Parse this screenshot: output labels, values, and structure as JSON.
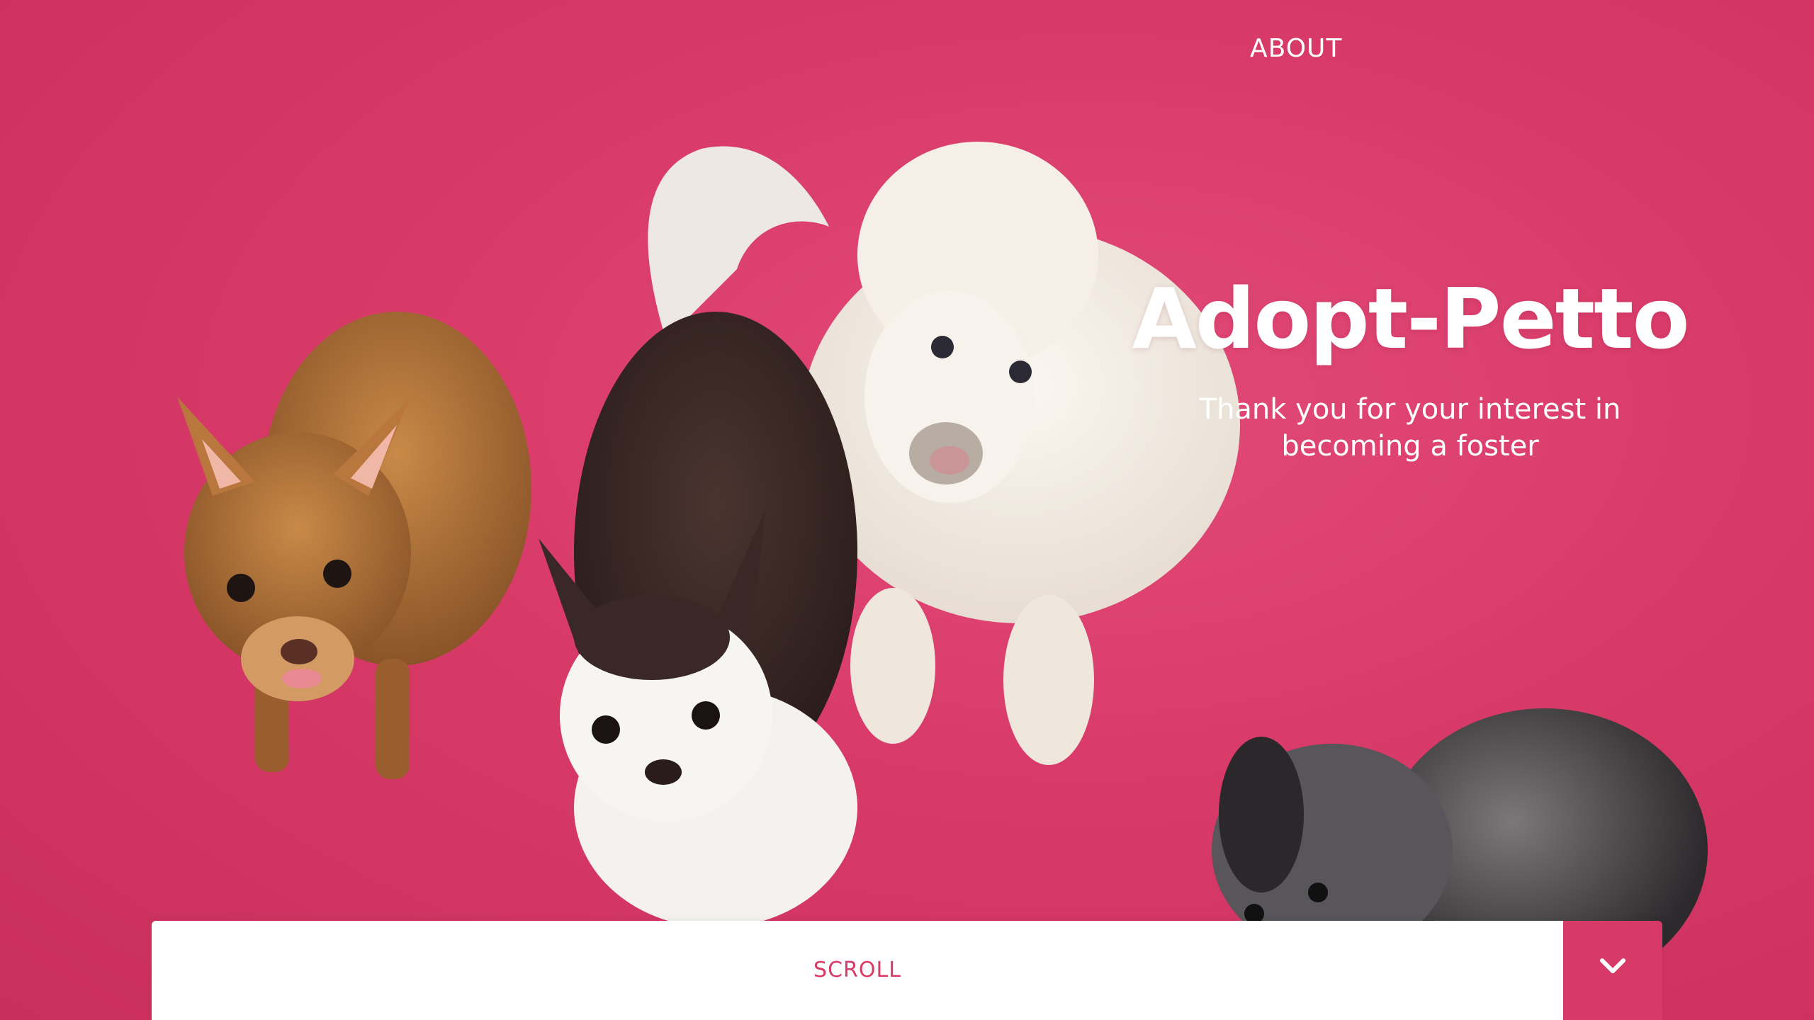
{
  "nav": {
    "about_label": "ABOUT"
  },
  "hero": {
    "title": "Adopt-Petto",
    "subtitle": "Thank you for your interest in becoming a foster",
    "background_color": "#d83a68"
  },
  "scroll_bar": {
    "label": "SCROLL",
    "button_icon": "chevron-down-icon",
    "accent_color": "#d83a68"
  }
}
